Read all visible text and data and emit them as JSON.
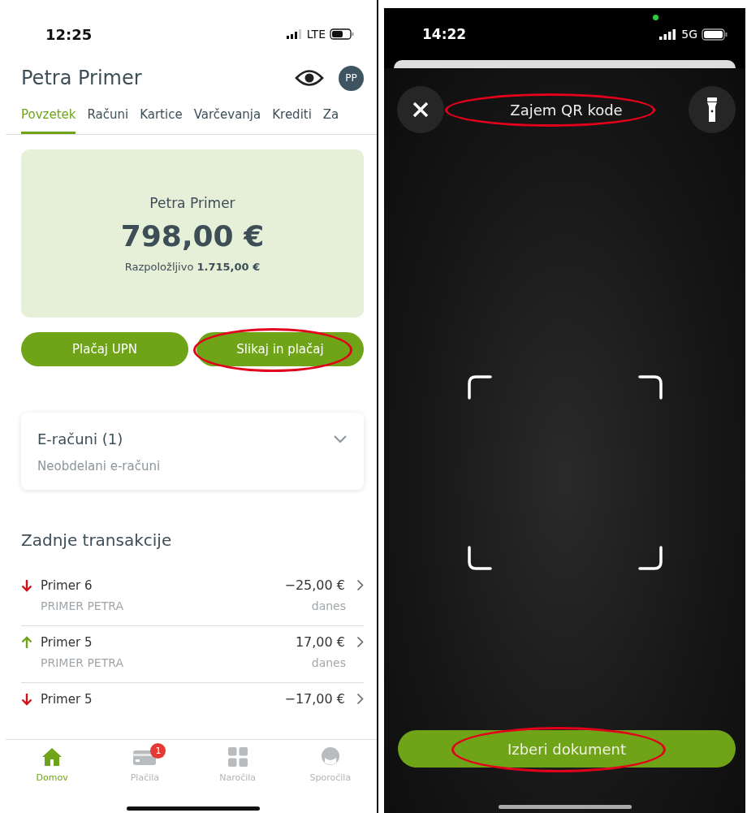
{
  "left_screen": {
    "status_bar": {
      "time": "12:25",
      "network": "LTE"
    },
    "header": {
      "title": "Petra Primer",
      "avatar": "PP"
    },
    "tabs": [
      {
        "label": "Povzetek",
        "selected": true
      },
      {
        "label": "Računi",
        "selected": false
      },
      {
        "label": "Kartice",
        "selected": false
      },
      {
        "label": "Varčevanja",
        "selected": false
      },
      {
        "label": "Krediti",
        "selected": false
      },
      {
        "label": "Za",
        "selected": false
      }
    ],
    "account_card": {
      "owner": "Petra Primer",
      "balance": "798,00 €",
      "available": "Razpoložljivo **1.715,00 €**"
    },
    "actions": [
      {
        "label": "Plačaj UPN",
        "highlighted": false
      },
      {
        "label": "Slikaj in plačaj",
        "highlighted": true
      }
    ],
    "e_bills": {
      "title": "E-računi (1)",
      "subtitle": "Neobdelani e-računi",
      "expanded": false
    },
    "transactions_title": "Zadnje transakcije",
    "transactions": [
      {
        "kind": "out",
        "name": "Primer 6",
        "amount": "−25,00 €",
        "party": "PRIMER PETRA",
        "date": "danes"
      },
      {
        "kind": "in",
        "name": "Primer 5",
        "amount": "17,00 €",
        "party": "PRIMER PETRA",
        "date": "danes"
      },
      {
        "kind": "out",
        "name": "Primer 5",
        "amount": "−17,00 €"
      }
    ],
    "bottom_nav": [
      {
        "kind": "home",
        "label": "Domov",
        "selected": true
      },
      {
        "kind": "card",
        "label": "Plačila",
        "selected": false,
        "badge": "1"
      },
      {
        "kind": "grid",
        "label": "Naročila",
        "selected": false
      },
      {
        "kind": "support",
        "label": "Sporočila",
        "selected": false
      }
    ]
  },
  "right_screen": {
    "status_bar": {
      "time": "14:22",
      "network": "5G"
    },
    "title": {
      "text": "Zajem QR kode",
      "highlighted": true
    },
    "button": {
      "label": "Izberi dokument",
      "highlighted": true
    }
  }
}
